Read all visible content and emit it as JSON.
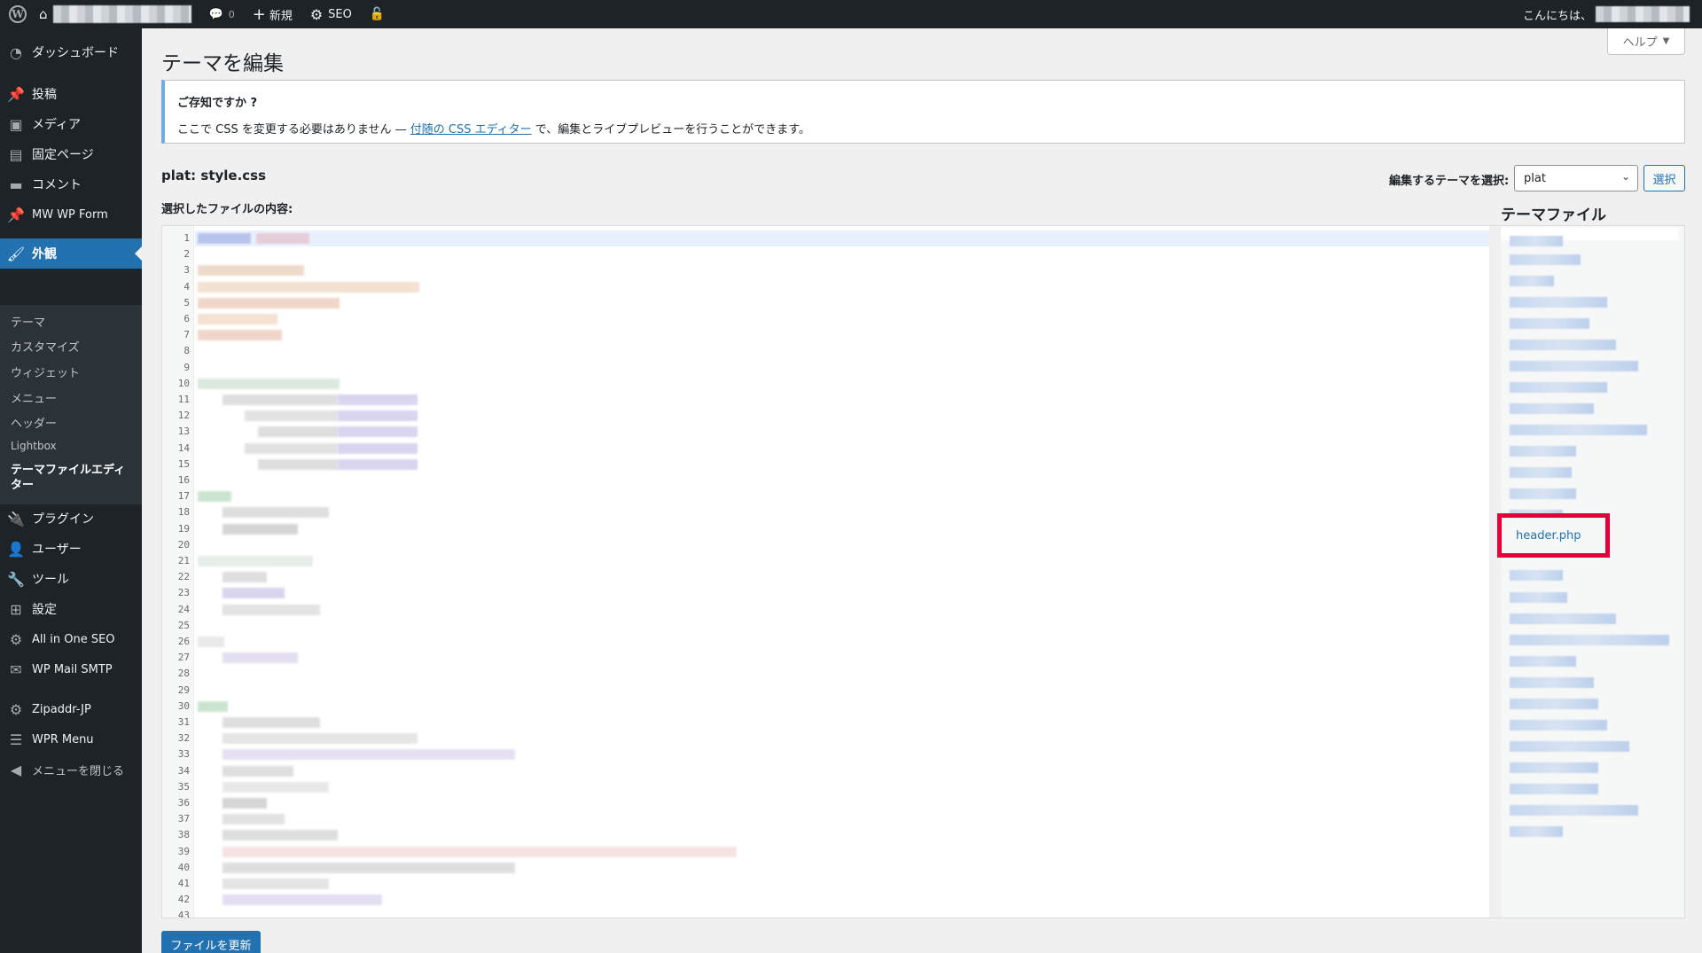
{
  "adminbar": {
    "comments_count": "0",
    "new_label": "新規",
    "seo_label": "SEO",
    "greeting": "こんにちは、"
  },
  "sidebar": {
    "items": [
      {
        "label": "ダッシュボード",
        "icon": "dashboard-icon"
      },
      {
        "label": "投稿",
        "icon": "pin-icon"
      },
      {
        "label": "メディア",
        "icon": "media-icon"
      },
      {
        "label": "固定ページ",
        "icon": "page-icon"
      },
      {
        "label": "コメント",
        "icon": "comment-icon"
      },
      {
        "label": "MW WP Form",
        "icon": "pin-icon"
      },
      {
        "label": "外観",
        "icon": "brush-icon"
      },
      {
        "label": "プラグイン",
        "icon": "plugin-icon"
      },
      {
        "label": "ユーザー",
        "icon": "user-icon"
      },
      {
        "label": "ツール",
        "icon": "wrench-icon"
      },
      {
        "label": "設定",
        "icon": "settings-icon"
      },
      {
        "label": "All in One SEO",
        "icon": "aioseo-icon"
      },
      {
        "label": "WP Mail SMTP",
        "icon": "mail-icon"
      },
      {
        "label": "Zipaddr-JP",
        "icon": "gear-icon"
      },
      {
        "label": "WPR Menu",
        "icon": "menu-lines-icon"
      },
      {
        "label": "メニューを閉じる",
        "icon": "collapse-icon"
      }
    ],
    "submenu": [
      "テーマ",
      "カスタマイズ",
      "ウィジェット",
      "メニュー",
      "ヘッダー",
      "Lightbox",
      "テーマファイルエディター"
    ]
  },
  "help_label": "ヘルプ",
  "page_title": "テーマを編集",
  "notice": {
    "title": "ご存知ですか ?",
    "text_before": "ここで CSS を変更する必要はありません — ",
    "link": "付随の CSS エディター",
    "text_after": " で、編集とライブプレビューを行うことができます。"
  },
  "file_title": "plat: style.css",
  "file_desc": "選択したファイルの内容:",
  "theme_select_label": "編集するテーマを選択:",
  "theme_select_value": "plat",
  "select_button": "選択",
  "theme_files_heading": "テーマファイル",
  "highlighted_file": "header.php",
  "update_button": "ファイルを更新",
  "line_numbers": [
    "1",
    "2",
    "3",
    "4",
    "5",
    "6",
    "7",
    "8",
    "9",
    "10",
    "11",
    "12",
    "13",
    "14",
    "15",
    "16",
    "17",
    "18",
    "19",
    "20",
    "21",
    "22",
    "23",
    "24",
    "25",
    "26",
    "27",
    "28",
    "29",
    "30",
    "31",
    "32",
    "33",
    "34",
    "35",
    "36",
    "37",
    "38",
    "39",
    "40",
    "41",
    "42",
    "43"
  ],
  "colors": {
    "accent": "#2271b1",
    "highlight_box": "#e4003a",
    "sidebar_bg": "#1d2327"
  }
}
